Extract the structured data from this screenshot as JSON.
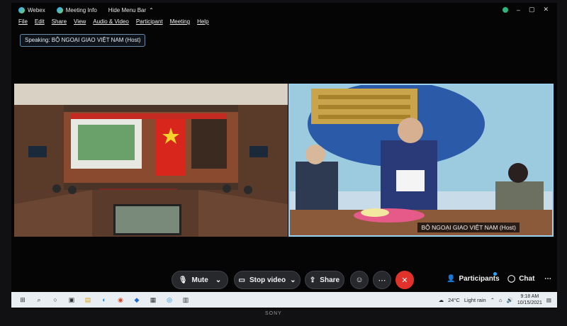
{
  "titlebar": {
    "app_name": "Webex",
    "meeting_info": "Meeting Info",
    "hide_menu_bar": "Hide Menu Bar"
  },
  "menu": [
    "File",
    "Edit",
    "Share",
    "View",
    "Audio & Video",
    "Participant",
    "Meeting",
    "Help"
  ],
  "speaking_label": "Speaking: BỘ NGOẠI GIAO VIỆT NAM (Host)",
  "video_right_name": "BỘ NGOẠI GIAO VIỆT NAM  (Host)",
  "controls": {
    "mute": "Mute",
    "stop_video": "Stop video",
    "share": "Share",
    "participants": "Participants",
    "chat": "Chat"
  },
  "taskbar": {
    "temperature": "24°C",
    "weather": "Light rain",
    "time": "9:18 AM",
    "date": "10/15/2021"
  },
  "monitor_brand": "SONY",
  "colors": {
    "end_call": "#e0322a",
    "accent": "#2ba3ff"
  }
}
